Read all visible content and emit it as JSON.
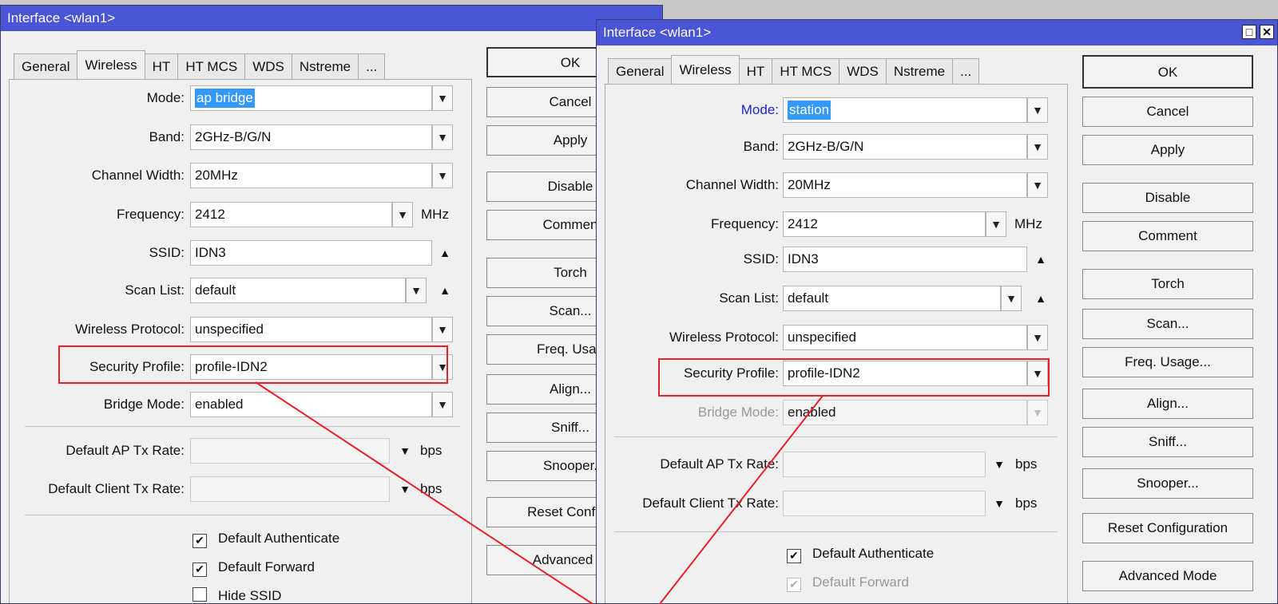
{
  "left": {
    "title": "Interface <wlan1>",
    "tabs": [
      "General",
      "Wireless",
      "HT",
      "HT MCS",
      "WDS",
      "Nstreme",
      "..."
    ],
    "mode": {
      "label": "Mode:",
      "value": "ap bridge"
    },
    "band": {
      "label": "Band:",
      "value": "2GHz-B/G/N"
    },
    "channel_width": {
      "label": "Channel Width:",
      "value": "20MHz"
    },
    "frequency": {
      "label": "Frequency:",
      "value": "2412",
      "unit": "MHz"
    },
    "ssid": {
      "label": "SSID:",
      "value": "IDN3"
    },
    "scan_list": {
      "label": "Scan List:",
      "value": "default"
    },
    "wireless_protocol": {
      "label": "Wireless Protocol:",
      "value": "unspecified"
    },
    "security_profile": {
      "label": "Security Profile:",
      "value": "profile-IDN2"
    },
    "bridge_mode": {
      "label": "Bridge Mode:",
      "value": "enabled"
    },
    "ap_tx_rate": {
      "label": "Default AP Tx Rate:",
      "value": "",
      "unit": "bps"
    },
    "client_tx_rate": {
      "label": "Default Client Tx Rate:",
      "value": "",
      "unit": "bps"
    },
    "checks": [
      {
        "label": "Default Authenticate",
        "checked": true
      },
      {
        "label": "Default Forward",
        "checked": true
      },
      {
        "label": "Hide SSID",
        "checked": false
      }
    ],
    "buttons": [
      "OK",
      "Cancel",
      "Apply",
      "Disable",
      "Commen",
      "Torch",
      "Scan...",
      "Freq. Usag",
      "Align...",
      "Sniff...",
      "Snooper.",
      "Reset Configu",
      "Advanced M"
    ]
  },
  "right": {
    "title": "Interface <wlan1>",
    "tabs": [
      "General",
      "Wireless",
      "HT",
      "HT MCS",
      "WDS",
      "Nstreme",
      "..."
    ],
    "mode": {
      "label": "Mode:",
      "value": "station"
    },
    "band": {
      "label": "Band:",
      "value": "2GHz-B/G/N"
    },
    "channel_width": {
      "label": "Channel Width:",
      "value": "20MHz"
    },
    "frequency": {
      "label": "Frequency:",
      "value": "2412",
      "unit": "MHz"
    },
    "ssid": {
      "label": "SSID:",
      "value": "IDN3"
    },
    "scan_list": {
      "label": "Scan List:",
      "value": "default"
    },
    "wireless_protocol": {
      "label": "Wireless Protocol:",
      "value": "unspecified"
    },
    "security_profile": {
      "label": "Security Profile:",
      "value": "profile-IDN2"
    },
    "bridge_mode": {
      "label": "Bridge Mode:",
      "value": "enabled"
    },
    "ap_tx_rate": {
      "label": "Default AP Tx Rate:",
      "value": "",
      "unit": "bps"
    },
    "client_tx_rate": {
      "label": "Default Client Tx Rate:",
      "value": "",
      "unit": "bps"
    },
    "checks": [
      {
        "label": "Default Authenticate",
        "checked": true
      },
      {
        "label": "Default Forward",
        "checked": true,
        "disabled": true
      }
    ],
    "buttons": [
      "OK",
      "Cancel",
      "Apply",
      "Disable",
      "Comment",
      "Torch",
      "Scan...",
      "Freq. Usage...",
      "Align...",
      "Sniff...",
      "Snooper...",
      "Reset Configuration",
      "Advanced Mode"
    ]
  },
  "icons": {
    "dropdown": "dropdown-arrow-icon",
    "collapse": "collapse-up-icon",
    "expand": "expand-down-icon",
    "maximize": "maximize-icon",
    "close": "close-icon",
    "check": "checkmark-icon"
  },
  "colors": {
    "titlebar": "#4a55d6",
    "highlight": "#e8202a",
    "selection": "#3399ff"
  }
}
